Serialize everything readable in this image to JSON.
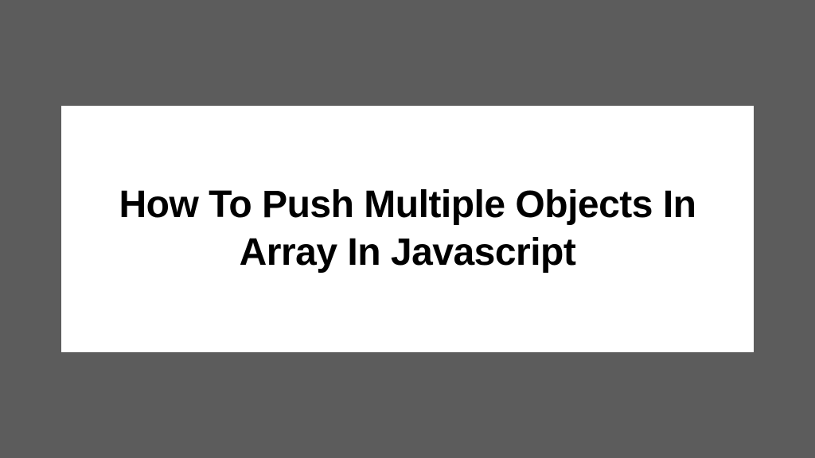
{
  "card": {
    "title": "How To Push Multiple Objects In Array In Javascript"
  },
  "colors": {
    "background": "#5c5c5c",
    "card_background": "#ffffff",
    "text": "#000000"
  }
}
